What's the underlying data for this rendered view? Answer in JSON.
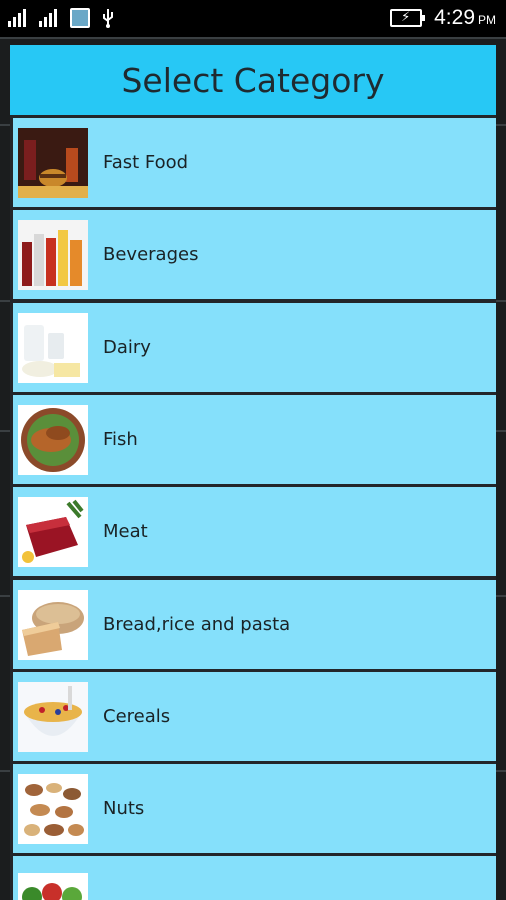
{
  "status_bar": {
    "signal1_label": "",
    "signal2_label": "",
    "time": "4:29",
    "ampm": "PM"
  },
  "dialog": {
    "title": "Select Category",
    "items": [
      {
        "label": "Fast Food",
        "icon": "fast-food-photo"
      },
      {
        "label": "Beverages",
        "icon": "beverages-photo"
      },
      {
        "label": "Dairy",
        "icon": "dairy-photo"
      },
      {
        "label": "Fish",
        "icon": "fish-photo"
      },
      {
        "label": "Meat",
        "icon": "meat-photo"
      },
      {
        "label": "Bread,rice and pasta",
        "icon": "bread-photo"
      },
      {
        "label": "Cereals",
        "icon": "cereals-photo"
      },
      {
        "label": "Nuts",
        "icon": "nuts-photo"
      },
      {
        "label": "",
        "icon": "vegetables-photo"
      }
    ]
  },
  "colors": {
    "header": "#27c8f5",
    "item_bg": "#85e0fb",
    "status_bar": "#000000"
  }
}
